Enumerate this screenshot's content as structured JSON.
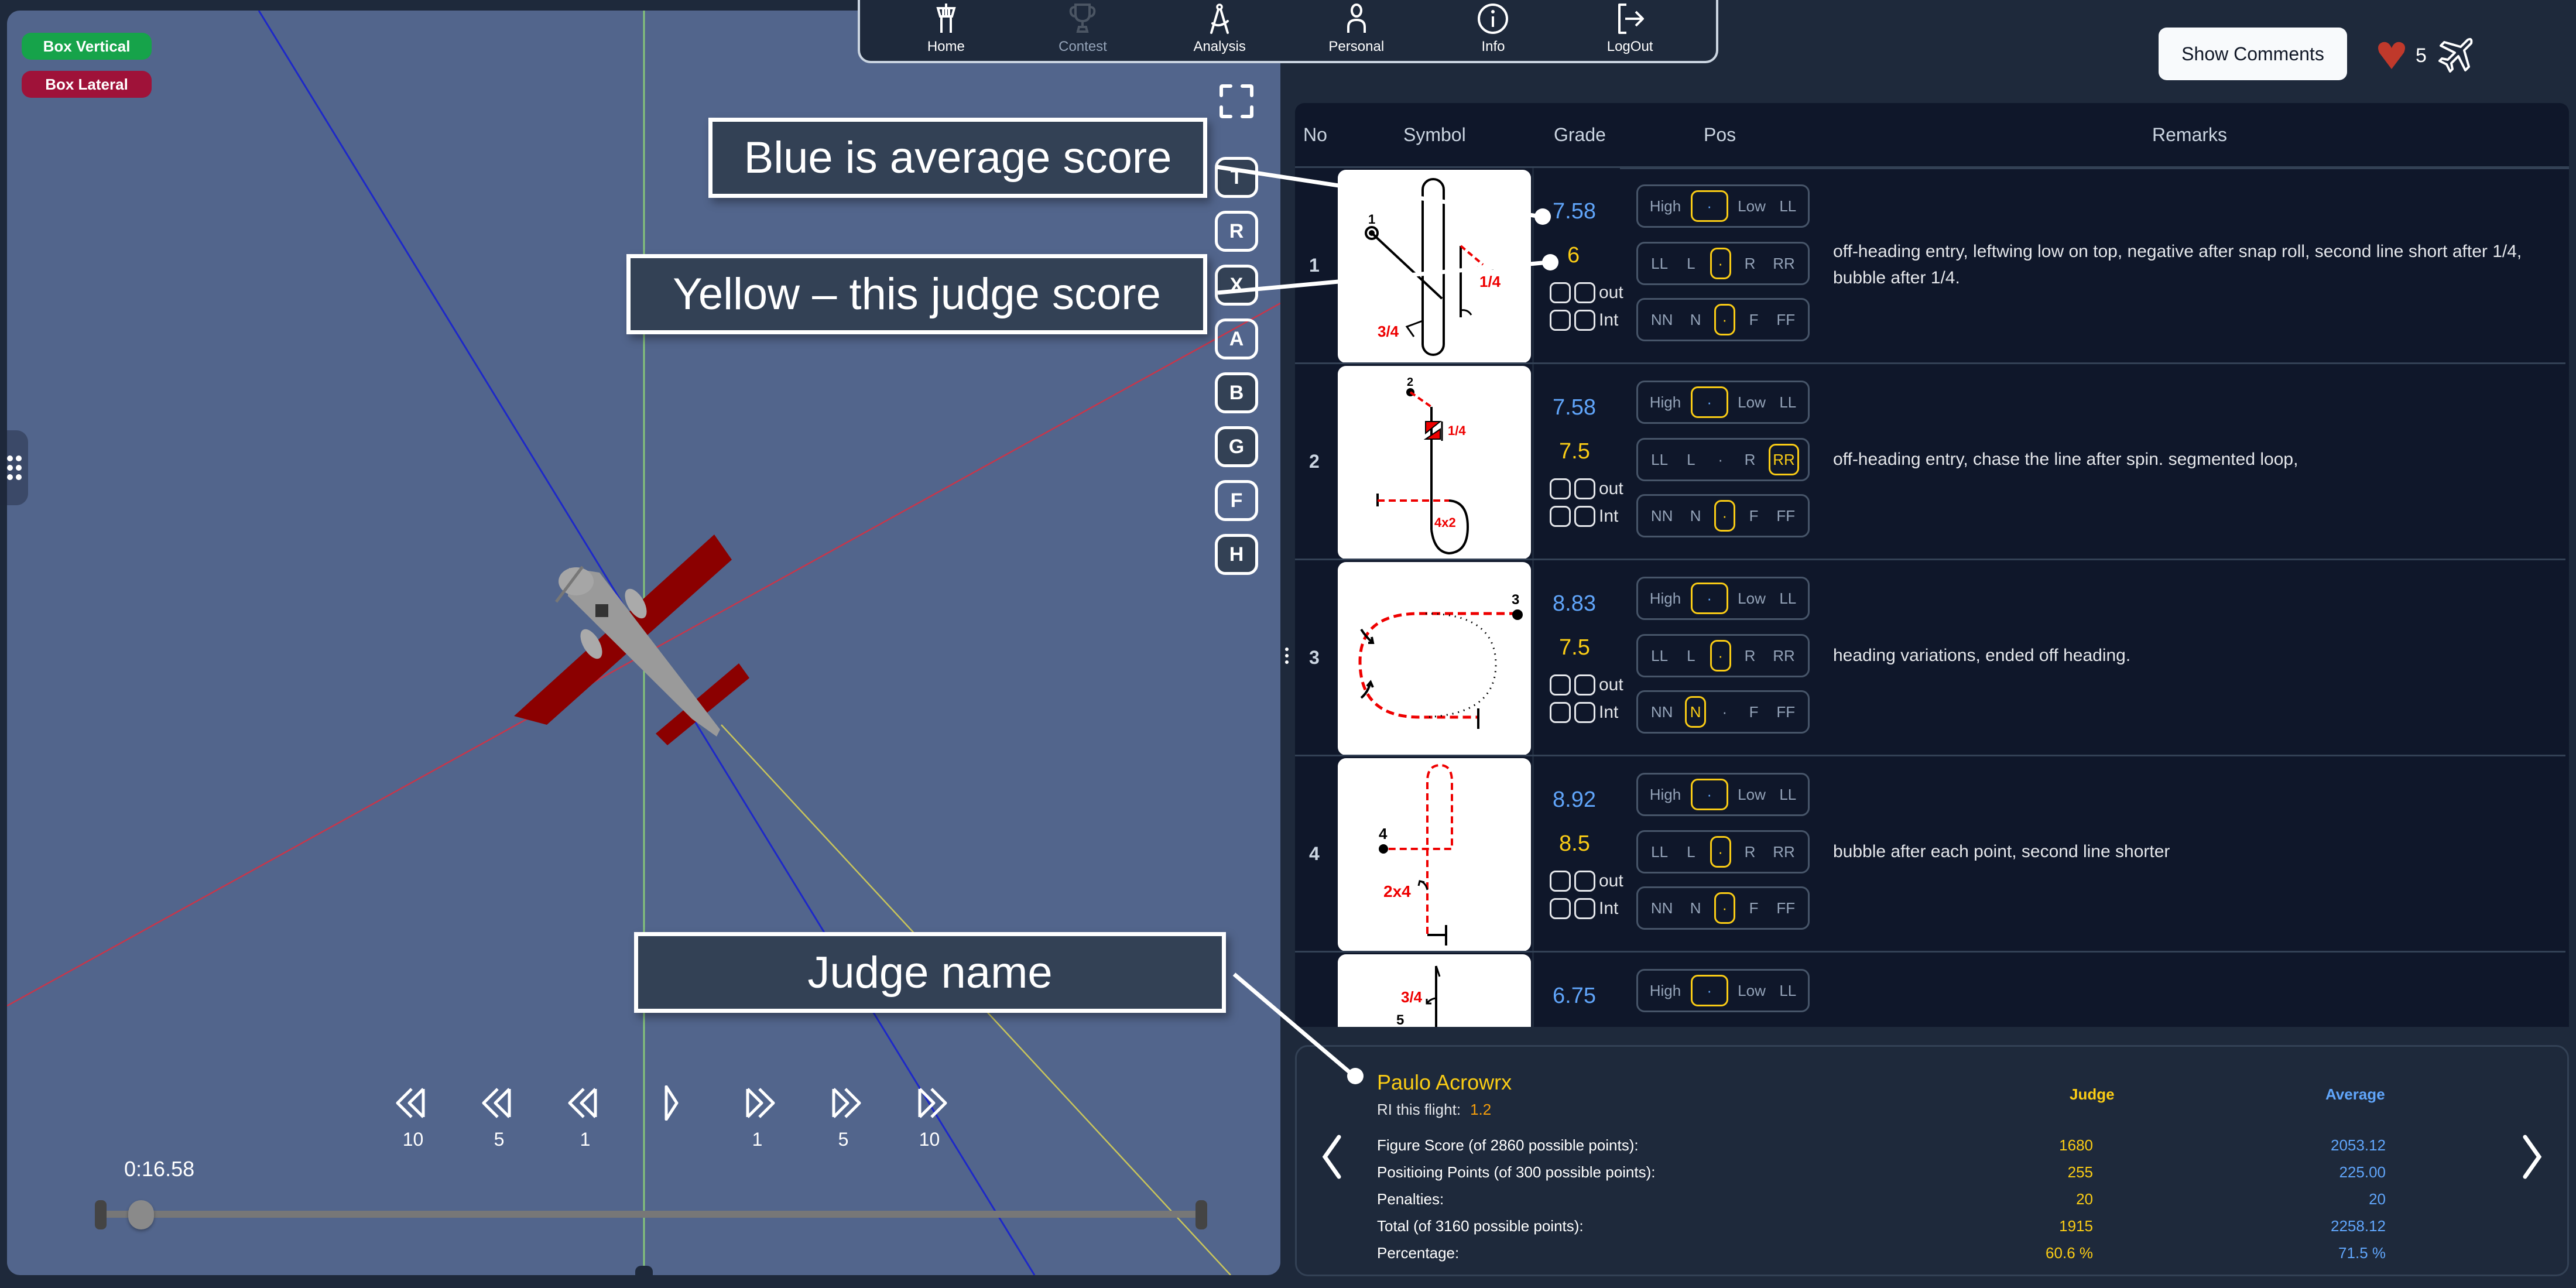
{
  "viewer": {
    "badges": [
      "Box Vertical",
      "Box Lateral"
    ],
    "view_buttons": [
      {
        "label": "T",
        "active": true
      },
      {
        "label": "R",
        "active": false
      },
      {
        "label": "X",
        "active": true
      },
      {
        "label": "A",
        "active": false
      },
      {
        "label": "B",
        "active": true
      },
      {
        "label": "G",
        "active": true
      },
      {
        "label": "F",
        "active": false
      },
      {
        "label": "H",
        "active": true
      }
    ],
    "playback": {
      "controls": [
        {
          "icon": "rewind-icon",
          "label": "10"
        },
        {
          "icon": "rewind-icon",
          "label": "5"
        },
        {
          "icon": "rewind-icon",
          "label": "1"
        },
        {
          "icon": "play-icon",
          "label": ""
        },
        {
          "icon": "fast-forward-icon",
          "label": "1"
        },
        {
          "icon": "fast-forward-icon",
          "label": "5"
        },
        {
          "icon": "fast-forward-icon",
          "label": "10"
        }
      ],
      "time": "0:16.58",
      "progress": 0.02
    }
  },
  "annotations": {
    "blue": "Blue is average score",
    "yellow": "Yellow – this judge score",
    "judge": "Judge name"
  },
  "nav": {
    "items": [
      {
        "label": "Home",
        "icon": "control-tower-icon",
        "disabled": false
      },
      {
        "label": "Contest",
        "icon": "trophy-icon",
        "disabled": true
      },
      {
        "label": "Analysis",
        "icon": "compass-icon",
        "disabled": false
      },
      {
        "label": "Personal",
        "icon": "person-icon",
        "disabled": false
      },
      {
        "label": "Info",
        "icon": "info-icon",
        "disabled": false
      },
      {
        "label": "LogOut",
        "icon": "logout-icon",
        "disabled": false
      }
    ]
  },
  "header_actions": {
    "show_comments": "Show Comments",
    "likes": "5",
    "heart_color": "#c0392b"
  },
  "table": {
    "columns": [
      "No",
      "Symbol",
      "Grade",
      "Pos",
      "Remarks"
    ],
    "rows": [
      {
        "no": "1",
        "avg": "7.58",
        "judge": "6",
        "pos_height": [
          "High",
          "·",
          "Low",
          "LL"
        ],
        "sel_height": 1,
        "pos_lateral": [
          "LL",
          "L",
          "·",
          "R",
          "RR"
        ],
        "sel_lateral": 2,
        "pos_depth": [
          "NN",
          "N",
          "·",
          "F",
          "FF"
        ],
        "sel_depth": 2,
        "remark": "off-heading entry, leftwing low on top, negative after snap roll, second line short after 1/4, bubble after 1/4."
      },
      {
        "no": "2",
        "avg": "7.58",
        "judge": "7.5",
        "pos_height": [
          "High",
          "·",
          "Low",
          "LL"
        ],
        "sel_height": 1,
        "pos_lateral": [
          "LL",
          "L",
          "·",
          "R",
          "RR"
        ],
        "sel_lateral": 4,
        "pos_depth": [
          "NN",
          "N",
          "·",
          "F",
          "FF"
        ],
        "sel_depth": 2,
        "remark": "off-heading entry, chase the line after spin. segmented loop,"
      },
      {
        "no": "3",
        "avg": "8.83",
        "judge": "7.5",
        "pos_height": [
          "High",
          "·",
          "Low",
          "LL"
        ],
        "sel_height": 1,
        "pos_lateral": [
          "LL",
          "L",
          "·",
          "R",
          "RR"
        ],
        "sel_lateral": 2,
        "pos_depth": [
          "NN",
          "N",
          "·",
          "F",
          "FF"
        ],
        "sel_depth": 1,
        "remark": "heading variations, ended off heading."
      },
      {
        "no": "4",
        "avg": "8.92",
        "judge": "8.5",
        "pos_height": [
          "High",
          "·",
          "Low",
          "LL"
        ],
        "sel_height": 1,
        "pos_lateral": [
          "LL",
          "L",
          "·",
          "R",
          "RR"
        ],
        "sel_lateral": 2,
        "pos_depth": [
          "NN",
          "N",
          "·",
          "F",
          "FF"
        ],
        "sel_depth": 2,
        "remark": "bubble after each point, second line shorter"
      },
      {
        "no": "5",
        "avg": "6.75",
        "judge": "",
        "pos_height": [
          "High",
          "·",
          "Low",
          "LL"
        ],
        "sel_height": 1,
        "remark": ""
      }
    ],
    "checkbox_labels": [
      "out",
      "Int"
    ],
    "symbol_labels": {
      "r1": [
        "1",
        "3/4",
        "1/4"
      ],
      "r2": [
        "2",
        "1/4",
        "4x2"
      ],
      "r3": [
        "3"
      ],
      "r4": [
        "4",
        "2x4"
      ],
      "r5": [
        "5",
        "3/4"
      ]
    }
  },
  "summary": {
    "judge_name": "Paulo Acrowrx",
    "ri_label": "RI this flight:",
    "ri_value": "1.2",
    "col_judge": "Judge",
    "col_average": "Average",
    "lines": [
      {
        "label": "Figure Score (of 2860 possible points):",
        "judge": "1680",
        "average": "2053.12"
      },
      {
        "label": "Positioing Points (of 300 possible points):",
        "judge": "255",
        "average": "225.00"
      },
      {
        "label": "Penalties:",
        "judge": "20",
        "average": "20"
      },
      {
        "label": "Total (of 3160 possible points):",
        "judge": "1915",
        "average": "2258.12"
      },
      {
        "label": "Percentage:",
        "judge": "60.6 %",
        "average": "71.5 %"
      }
    ]
  }
}
